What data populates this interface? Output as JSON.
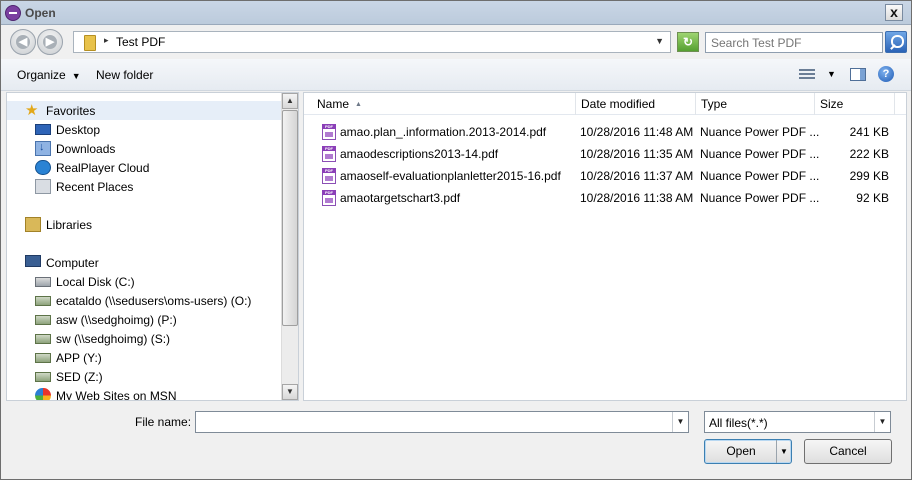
{
  "window": {
    "title": "Open",
    "close_glyph": "x"
  },
  "nav": {
    "back_glyph": "◀",
    "forward_glyph": "▶",
    "breadcrumb_sep": "▸",
    "breadcrumb": "Test PDF",
    "address_dropdown_glyph": "▼",
    "refresh_glyph": "↻",
    "search_placeholder": "Search Test PDF"
  },
  "toolbar": {
    "organize_label": "Organize",
    "organize_caret": "▼",
    "new_folder_label": "New folder",
    "view_dropdown_glyph": "▼",
    "help_glyph": "?"
  },
  "sidebar": {
    "favorites": {
      "label": "Favorites",
      "icon": "star-icon"
    },
    "favorites_items": [
      {
        "label": "Desktop",
        "icon": "desktop-icon"
      },
      {
        "label": "Downloads",
        "icon": "downloads-icon"
      },
      {
        "label": "RealPlayer Cloud",
        "icon": "realplayer-icon"
      },
      {
        "label": "Recent Places",
        "icon": "recent-places-icon"
      }
    ],
    "libraries": {
      "label": "Libraries",
      "icon": "libraries-icon"
    },
    "computer": {
      "label": "Computer",
      "icon": "computer-icon"
    },
    "computer_items": [
      {
        "label": "Local Disk (C:)",
        "icon": "local-disk-icon"
      },
      {
        "label": "ecataldo (\\\\sedusers\\oms-users) (O:)",
        "icon": "network-drive-icon"
      },
      {
        "label": "asw (\\\\sedghoimg) (P:)",
        "icon": "network-drive-icon"
      },
      {
        "label": "sw (\\\\sedghoimg) (S:)",
        "icon": "network-drive-icon"
      },
      {
        "label": "APP (Y:)",
        "icon": "network-drive-icon"
      },
      {
        "label": "SED (Z:)",
        "icon": "network-drive-icon"
      },
      {
        "label": "My Web Sites on MSN",
        "icon": "msn-icon"
      }
    ],
    "scroll_up_glyph": "▲",
    "scroll_down_glyph": "▼"
  },
  "file_list": {
    "columns": {
      "name": "Name",
      "name_sort_glyph": "▲",
      "date": "Date modified",
      "type": "Type",
      "size": "Size"
    },
    "rows": [
      {
        "name": "amao.plan_.information.2013-2014.pdf",
        "date": "10/28/2016 11:48 AM",
        "type": "Nuance Power PDF ...",
        "size": "241 KB"
      },
      {
        "name": "amaodescriptions2013-14.pdf",
        "date": "10/28/2016 11:35 AM",
        "type": "Nuance Power PDF ...",
        "size": "222 KB"
      },
      {
        "name": "amaoself-evaluationplanletter2015-16.pdf",
        "date": "10/28/2016 11:37 AM",
        "type": "Nuance Power PDF ...",
        "size": "299 KB"
      },
      {
        "name": "amaotargetschart3.pdf",
        "date": "10/28/2016 11:38 AM",
        "type": "Nuance Power PDF ...",
        "size": "92 KB"
      }
    ]
  },
  "footer": {
    "file_name_label": "File name:",
    "file_name_value": "",
    "file_name_dropdown_glyph": "▼",
    "filter_value": "All files(*.*)",
    "filter_dropdown_glyph": "▼",
    "open_label": "Open",
    "open_split_glyph": "▼",
    "cancel_label": "Cancel"
  }
}
